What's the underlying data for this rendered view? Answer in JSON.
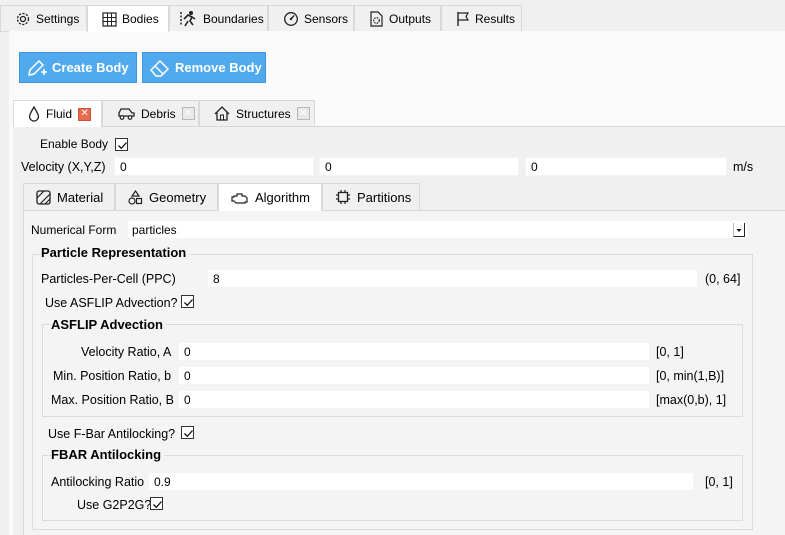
{
  "top_tabs": [
    {
      "label": "Settings",
      "icon": "gear-icon"
    },
    {
      "label": "Bodies",
      "icon": "grid-icon"
    },
    {
      "label": "Boundaries",
      "icon": "runner-icon"
    },
    {
      "label": "Sensors",
      "icon": "gauge-icon"
    },
    {
      "label": "Outputs",
      "icon": "file-gear-icon"
    },
    {
      "label": "Results",
      "icon": "flag-icon"
    }
  ],
  "toolbar": {
    "create_label": "Create Body",
    "remove_label": "Remove Body"
  },
  "body_tabs": [
    {
      "label": "Fluid",
      "icon": "drop-icon"
    },
    {
      "label": "Debris",
      "icon": "car-icon"
    },
    {
      "label": "Structures",
      "icon": "house-icon"
    }
  ],
  "enable_body": {
    "label": "Enable Body",
    "checked": true
  },
  "velocity": {
    "label": "Velocity (X,Y,Z)",
    "x": "0",
    "y": "0",
    "z": "0",
    "unit": "m/s"
  },
  "sub_tabs": [
    {
      "label": "Material",
      "icon": "material-icon"
    },
    {
      "label": "Geometry",
      "icon": "shapes-icon"
    },
    {
      "label": "Algorithm",
      "icon": "engine-icon"
    },
    {
      "label": "Partitions",
      "icon": "chip-icon"
    }
  ],
  "numerical_form": {
    "label": "Numerical Form",
    "value": "particles"
  },
  "particle_rep": {
    "title": "Particle Representation",
    "ppc_label": "Particles-Per-Cell (PPC)",
    "ppc_value": "8",
    "ppc_range": "(0, 64]",
    "asflip_label": "Use ASFLIP Advection?"
  },
  "asflip": {
    "title": "ASFLIP Advection",
    "velocity_ratio_label": "Velocity Ratio, A",
    "velocity_ratio_value": "0",
    "velocity_ratio_range": "[0, 1]",
    "min_pos_label": "Min. Position Ratio, b",
    "min_pos_value": "0",
    "min_pos_range": "[0, min(1,B)]",
    "max_pos_label": "Max. Position Ratio, B",
    "max_pos_value": "0",
    "max_pos_range": "[max(0,b), 1]"
  },
  "fbar_checkbox_label": "Use F-Bar Antilocking?",
  "fbar": {
    "title": "FBAR Antilocking",
    "ratio_label": "Antilocking Ratio",
    "ratio_value": "0.9",
    "ratio_range": "[0, 1]",
    "g2p2g_label": "Use G2P2G?"
  },
  "colors": {
    "button": "#52aaee",
    "close_active": "#e96b4d"
  }
}
